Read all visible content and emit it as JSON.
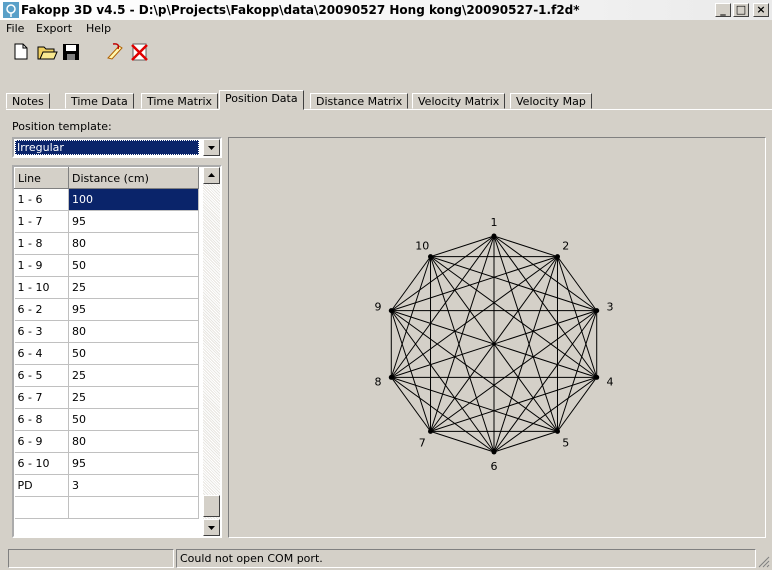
{
  "window": {
    "title": "Fakopp 3D v4.5 - D:\\p\\Projects\\Fakopp\\data\\20090527 Hong kong\\20090527-1.f2d*",
    "minimize": "_",
    "maximize": "□",
    "close": "×"
  },
  "menu": {
    "file": "File",
    "export": "Export",
    "help": "Help"
  },
  "toolbar": {
    "icons": [
      "new-icon",
      "open-icon",
      "save-icon",
      "draw-line-icon",
      "delete-icon"
    ]
  },
  "tabs": [
    {
      "label": "Notes"
    },
    {
      "label": "Time Data"
    },
    {
      "label": "Time Matrix"
    },
    {
      "label": "Position Data",
      "active": true
    },
    {
      "label": "Distance Matrix"
    },
    {
      "label": "Velocity Matrix"
    },
    {
      "label": "Velocity Map"
    }
  ],
  "position": {
    "template_label": "Position template:",
    "template_value": "Irregular"
  },
  "table": {
    "headers": [
      "Line",
      "Distance (cm)"
    ],
    "rows": [
      [
        "1 - 6",
        "100"
      ],
      [
        "1 - 7",
        "95"
      ],
      [
        "1 - 8",
        "80"
      ],
      [
        "1 - 9",
        "50"
      ],
      [
        "1 - 10",
        "25"
      ],
      [
        "6 - 2",
        "95"
      ],
      [
        "6 - 3",
        "80"
      ],
      [
        "6 - 4",
        "50"
      ],
      [
        "6 - 5",
        "25"
      ],
      [
        "6 - 7",
        "25"
      ],
      [
        "6 - 8",
        "50"
      ],
      [
        "6 - 9",
        "80"
      ],
      [
        "6 - 10",
        "95"
      ],
      [
        "PD",
        "3"
      ]
    ]
  },
  "diagram": {
    "sensors": [
      "1",
      "2",
      "3",
      "4",
      "5",
      "6",
      "7",
      "8",
      "9",
      "10"
    ]
  },
  "status": {
    "panel1": "",
    "message": "Could not open COM port."
  }
}
